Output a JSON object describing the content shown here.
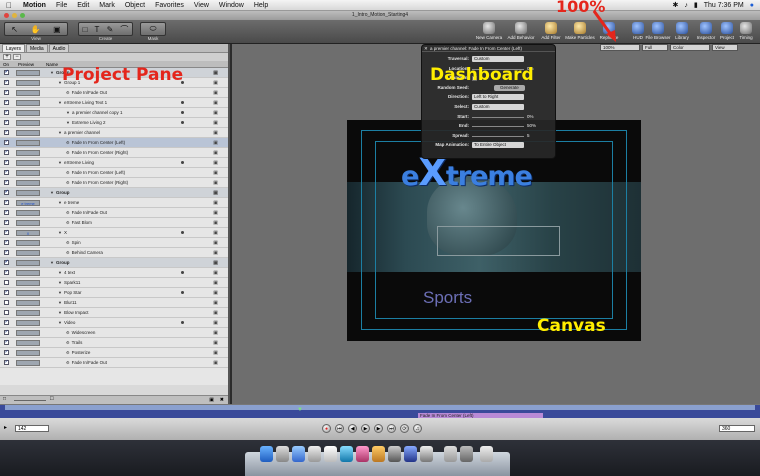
{
  "menubar": {
    "app": "Motion",
    "items": [
      "File",
      "Edit",
      "Mark",
      "Object",
      "Favorites",
      "View",
      "Window",
      "Help"
    ],
    "clock": "Thu 7:36 PM"
  },
  "window": {
    "title": "1_Intro_Motion_Starting4"
  },
  "toolbar": {
    "left_labels": [
      "View",
      "Create",
      "Mask"
    ],
    "buttons": [
      "New Camera",
      "Add Behavior",
      "Add Filter",
      "Make Particles",
      "Replicate",
      "HUD",
      "File Browser",
      "Library",
      "Inspector",
      "Project",
      "Timing"
    ]
  },
  "view_controls": {
    "zoom": "100%",
    "resolution": "Full",
    "channels": "Color",
    "view": "View"
  },
  "project_pane": {
    "tabs": [
      "Layers",
      "Media",
      "Audio"
    ],
    "columns": [
      "On",
      "Preview",
      "Name"
    ],
    "rows": [
      {
        "name": "Group 1",
        "level": 1,
        "kind": "group",
        "checked": true,
        "dot": false,
        "preview": ""
      },
      {
        "name": "Group 1",
        "level": 2,
        "kind": "layer",
        "checked": true,
        "dot": true,
        "preview": ""
      },
      {
        "name": "Fade In/Fade Out",
        "level": 3,
        "kind": "behavior",
        "checked": true,
        "dot": false,
        "preview": ""
      },
      {
        "name": "eXtreme Living Text 1",
        "level": 2,
        "kind": "layer",
        "checked": true,
        "dot": true,
        "preview": ""
      },
      {
        "name": "a premier channel copy 1",
        "level": 3,
        "kind": "layer",
        "checked": true,
        "dot": true,
        "preview": ""
      },
      {
        "name": "Extreme Living 2",
        "level": 3,
        "kind": "layer",
        "checked": true,
        "dot": true,
        "preview": ""
      },
      {
        "name": "a premier channel",
        "level": 2,
        "kind": "layer",
        "checked": true,
        "dot": false,
        "preview": ""
      },
      {
        "name": "Fade In From Center (Left)",
        "level": 3,
        "kind": "behavior",
        "checked": true,
        "dot": false,
        "preview": "",
        "selected": true
      },
      {
        "name": "Fade In From Center (Right)",
        "level": 3,
        "kind": "behavior",
        "checked": true,
        "dot": false,
        "preview": ""
      },
      {
        "name": "eXtreme Living",
        "level": 2,
        "kind": "layer",
        "checked": true,
        "dot": true,
        "preview": ""
      },
      {
        "name": "Fade In From Center (Left)",
        "level": 3,
        "kind": "behavior",
        "checked": true,
        "dot": false,
        "preview": ""
      },
      {
        "name": "Fade In From Center (Right)",
        "level": 3,
        "kind": "behavior",
        "checked": true,
        "dot": false,
        "preview": ""
      },
      {
        "name": "Group",
        "level": 1,
        "kind": "group",
        "checked": true,
        "dot": false,
        "preview": ""
      },
      {
        "name": "e  treme",
        "level": 2,
        "kind": "layer",
        "checked": true,
        "dot": false,
        "preview": "e treme"
      },
      {
        "name": "Fade In/Fade Out",
        "level": 3,
        "kind": "behavior",
        "checked": true,
        "dot": false,
        "preview": ""
      },
      {
        "name": "Fast Blom",
        "level": 3,
        "kind": "behavior",
        "checked": true,
        "dot": false,
        "preview": ""
      },
      {
        "name": "X",
        "level": 2,
        "kind": "layer",
        "checked": true,
        "dot": true,
        "preview": "X"
      },
      {
        "name": "Spin",
        "level": 3,
        "kind": "behavior",
        "checked": true,
        "dot": false,
        "preview": ""
      },
      {
        "name": "Behind Camera",
        "level": 3,
        "kind": "behavior",
        "checked": true,
        "dot": false,
        "preview": ""
      },
      {
        "name": "Group",
        "level": 1,
        "kind": "group",
        "checked": true,
        "dot": false,
        "preview": ""
      },
      {
        "name": "4 text",
        "level": 2,
        "kind": "layer",
        "checked": true,
        "dot": true,
        "preview": ""
      },
      {
        "name": "Spark11",
        "level": 2,
        "kind": "layer",
        "checked": false,
        "dot": false,
        "preview": ""
      },
      {
        "name": "Pop Star",
        "level": 2,
        "kind": "layer",
        "checked": true,
        "dot": true,
        "preview": ""
      },
      {
        "name": "Blur11",
        "level": 2,
        "kind": "layer",
        "checked": false,
        "dot": false,
        "preview": ""
      },
      {
        "name": "Blow Impact",
        "level": 2,
        "kind": "layer",
        "checked": false,
        "dot": false,
        "preview": ""
      },
      {
        "name": "Video",
        "level": 2,
        "kind": "layer",
        "checked": true,
        "dot": true,
        "preview": ""
      },
      {
        "name": "Widescreen",
        "level": 3,
        "kind": "filter",
        "checked": true,
        "dot": false,
        "preview": ""
      },
      {
        "name": "Trails",
        "level": 3,
        "kind": "filter",
        "checked": true,
        "dot": false,
        "preview": ""
      },
      {
        "name": "Posterize",
        "level": 3,
        "kind": "filter",
        "checked": true,
        "dot": false,
        "preview": ""
      },
      {
        "name": "Fade In/Fade Out",
        "level": 3,
        "kind": "behavior",
        "checked": true,
        "dot": false,
        "preview": ""
      }
    ]
  },
  "dashboard": {
    "title": "a premier channel: Fade In From Center (Left)",
    "rows": [
      {
        "label": "Traversal:",
        "value": "Custom",
        "type": "popup"
      },
      {
        "label": "Location:",
        "value": "0%",
        "type": "slider"
      },
      {
        "label": "Random:",
        "value": "",
        "type": "check"
      },
      {
        "label": "Random Seed:",
        "value": "Generate",
        "type": "button"
      },
      {
        "label": "Direction:",
        "value": "Left to Right",
        "type": "popup"
      },
      {
        "label": "Select:",
        "value": "Custom",
        "type": "popup"
      },
      {
        "label": "Start:",
        "value": "0%",
        "type": "slider"
      },
      {
        "label": "End:",
        "value": "50%",
        "type": "slider"
      },
      {
        "label": "Spread:",
        "value": "5",
        "type": "slider"
      },
      {
        "label": "Map Animation:",
        "value": "To Entire Object",
        "type": "popup"
      }
    ]
  },
  "canvas": {
    "brand_small_e": "e",
    "brand_big_x": "X",
    "brand_rest": "treme",
    "headline": "Sports"
  },
  "timeline": {
    "clip_label": "Fade In From Center (Left)"
  },
  "transport": {
    "start": "142",
    "end": "360"
  },
  "annotations": {
    "project_pane": "Project Pane",
    "dashboard": "Dashboard",
    "canvas": "Canvas",
    "zoom": "100%"
  },
  "colors": {
    "annotation_red": "#e4261c",
    "annotation_yellow": "#ffee00",
    "brand_blue": "#3b7fe0",
    "timeline_blue": "#3a4a9a"
  }
}
